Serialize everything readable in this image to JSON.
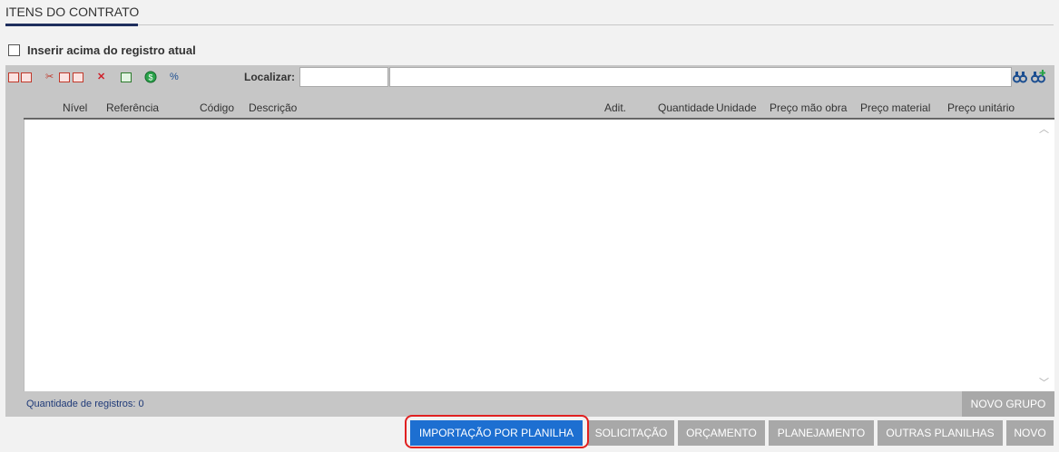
{
  "section": {
    "title": "ITENS DO CONTRATO"
  },
  "insert_option": {
    "label": "Inserir acima do registro atual",
    "checked": false
  },
  "toolbar": {
    "icons": [
      "new-folder-icon",
      "new-check-icon",
      "cut-icon",
      "copy-icon",
      "paste-icon",
      "delete-icon",
      "duplicate-icon",
      "money-icon",
      "percent-icon"
    ],
    "delete_glyph": "✕",
    "percent_glyph": "%",
    "find_label": "Localizar:"
  },
  "grid": {
    "columns": [
      "Nível",
      "Referência",
      "Código",
      "Descrição",
      "Adit.",
      "Quantidade",
      "Unidade",
      "Preço mão obra",
      "Preço material",
      "Preço unitário"
    ],
    "rows": [],
    "records_label": "Quantidade de registros: 0",
    "new_group_label": "NOVO GRUPO"
  },
  "actions": {
    "import_label": "IMPORTAÇÃO POR PLANILHA",
    "request_label": "SOLICITAÇÃO",
    "budget_label": "ORÇAMENTO",
    "planning_label": "PLANEJAMENTO",
    "other_sheets_label": "OUTRAS PLANILHAS",
    "new_label": "NOVO"
  },
  "colors": {
    "primary": "#1d6fd1",
    "highlight": "#e02020",
    "gray_button": "#a8a8a8",
    "toolbar": "#c6c6c6"
  }
}
